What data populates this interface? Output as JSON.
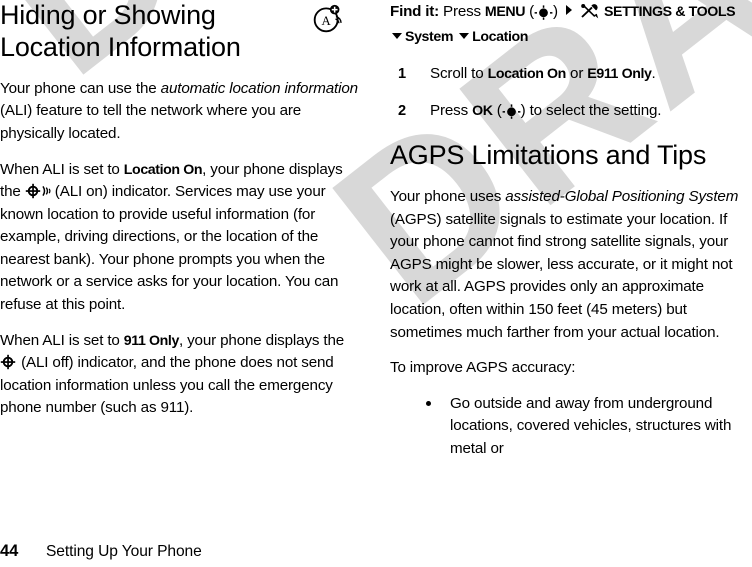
{
  "page": {
    "number": "44",
    "chapter": "Setting Up Your Phone",
    "watermark": "DRAFT",
    "watermark_color": "#d8d8d8"
  },
  "left_column": {
    "title": "Hiding or Showing Location Information",
    "topic_icon": "location-badge-icon",
    "paragraphs": [
      {
        "id": "p1",
        "parts": [
          {
            "type": "text",
            "value": "Your phone can use the "
          },
          {
            "type": "italic",
            "value": "automatic location information"
          },
          {
            "type": "text",
            "value": " (ALI) feature to tell the network where you are physically located."
          }
        ]
      },
      {
        "id": "p2",
        "parts": [
          {
            "type": "text",
            "value": "When ALI is set to "
          },
          {
            "type": "ui-term",
            "value": "Location On"
          },
          {
            "type": "text",
            "value": ", your phone displays the "
          },
          {
            "type": "icon",
            "value": "ali-on-indicator-icon"
          },
          {
            "type": "text",
            "value": " (ALI on) indicator. Services may use your known location to provide useful information (for example, driving directions, or the location of the nearest bank). Your phone prompts you when the network or a service asks for your location. You can refuse at this point."
          }
        ]
      },
      {
        "id": "p3",
        "parts": [
          {
            "type": "text",
            "value": "When ALI is set to "
          },
          {
            "type": "ui-term",
            "value": "911 Only"
          },
          {
            "type": "text",
            "value": ", your phone displays the "
          },
          {
            "type": "icon",
            "value": "ali-off-indicator-icon"
          },
          {
            "type": "text",
            "value": " (ALI off) indicator, and the phone does not send location information unless you call the emergency phone number (such as 911)."
          }
        ]
      }
    ]
  },
  "right_column": {
    "find_it": {
      "lead": "Find it:",
      "press_word": "Press",
      "menu_key": "MENU",
      "nav_key_icon": "nav-key-icon",
      "arrow_icon": "right-arrow-icon",
      "settings_icon": "settings-and-tools-icon",
      "settings_label": "SETTINGS & TOOLS",
      "path": [
        {
          "caret": "chevron-down-icon",
          "label": "System"
        },
        {
          "caret": "chevron-down-icon",
          "label": "Location"
        }
      ]
    },
    "steps": [
      {
        "num": "1",
        "parts": [
          {
            "type": "text",
            "value": "Scroll to "
          },
          {
            "type": "ui-term",
            "value": "Location On"
          },
          {
            "type": "text",
            "value": " or "
          },
          {
            "type": "ui-term",
            "value": "E911 Only"
          },
          {
            "type": "text",
            "value": "."
          }
        ]
      },
      {
        "num": "2",
        "parts": [
          {
            "type": "text",
            "value": "Press "
          },
          {
            "type": "ui-term",
            "value": "OK"
          },
          {
            "type": "text",
            "value": " ("
          },
          {
            "type": "icon",
            "value": "nav-key-icon"
          },
          {
            "type": "text",
            "value": ") to select the setting."
          }
        ]
      }
    ],
    "agps": {
      "title": "AGPS Limitations and Tips",
      "paragraph_1": {
        "parts": [
          {
            "type": "text",
            "value": "Your phone uses "
          },
          {
            "type": "italic",
            "value": "assisted-Global Positioning System"
          },
          {
            "type": "text",
            "value": " (AGPS) satellite signals to estimate your location. If your phone cannot find strong satellite signals, your AGPS might be slower, less accurate, or it might not work at all. AGPS provides only an approximate location, often within 150 feet (45 meters) but sometimes much farther from your actual location."
          }
        ]
      },
      "paragraph_2": "To improve AGPS accuracy:",
      "bullets": [
        "Go outside and away from underground locations, covered vehicles, structures with metal or"
      ]
    }
  }
}
